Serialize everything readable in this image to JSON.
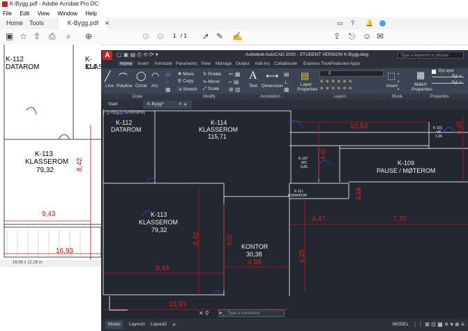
{
  "acrobat": {
    "window_title": "K-Bygg.pdf - Adobe Acrobat Pro DC",
    "menu": [
      "File",
      "Edit",
      "View",
      "Window",
      "Help"
    ],
    "tabs": {
      "home": "Home",
      "tools": "Tools",
      "doc": "K-Bygg.pdf"
    },
    "page_current": "1",
    "page_total": "/ 1",
    "status_size": "16,56 x 12,26 in",
    "rooms": [
      {
        "code": "K-112",
        "name": "DATAROM"
      },
      {
        "code": "K-113",
        "name": "KLASSEROM",
        "area": "79,32"
      },
      {
        "code": "K-114",
        "name": "KLASSE"
      }
    ],
    "dims": [
      "8,42",
      "9,43",
      "16,93"
    ]
  },
  "autocad": {
    "title": "Autodesk AutoCAD 2020 - STUDENT VERSION    K-Bygg.dwg",
    "search_placeholder": "Type a keyword or phrase",
    "ribbon_tabs": [
      "Home",
      "Insert",
      "Annotate",
      "Parametric",
      "View",
      "Manage",
      "Output",
      "Add-ins",
      "Collaborate",
      "Express Tools",
      "Featured Apps"
    ],
    "draw_tools": [
      "Line",
      "Polyline",
      "Circle",
      "Arc"
    ],
    "modify_tools": [
      "Move",
      "Rotate",
      "Copy",
      "Mirror",
      "Stretch",
      "Scale"
    ],
    "annotation_tools": [
      "Text",
      "Dimension"
    ],
    "layer_tools": [
      "Layer Properties"
    ],
    "layer_value": "0",
    "block_tools": [
      "Insert"
    ],
    "properties_tools": [
      "Match Properties"
    ],
    "bylayer": [
      "ByLayer",
      "ByLa",
      "ByLa"
    ],
    "panels": [
      "Draw",
      "Modify",
      "Annotation",
      "Layers",
      "Block",
      "Properties"
    ],
    "file_tabs": {
      "start": "Start",
      "doc": "K-Bygg*"
    },
    "viewport_label": "[−][Top][2D Wireframe]",
    "rooms": [
      {
        "code": "K-112",
        "name": "DATAROM"
      },
      {
        "code": "K-114",
        "name": "KLASSEROM",
        "area": "115,71"
      },
      {
        "code": "K-101",
        "name": "VF",
        "area": "1,96"
      },
      {
        "code": "K-107",
        "name": "WC",
        "area": "6,85"
      },
      {
        "code": "K-109",
        "name": "PAUSE / MØTEROM"
      },
      {
        "code": "K-111",
        "name": "KORRIDOR"
      },
      {
        "code": "K-113",
        "name": "KLASSEROM",
        "area": "79,32"
      },
      {
        "code": "",
        "name": "KONTOR",
        "area": "30,38"
      }
    ],
    "dims": [
      "10,53",
      "8,45",
      "4,45",
      "2,19",
      "4,47",
      "7,70",
      "8,42",
      "8,02",
      "6,25",
      "9,43",
      "4,58",
      "16,93"
    ],
    "command_placeholder": "Type a command",
    "layout_tabs": [
      "Model",
      "Layout1",
      "Layout2"
    ],
    "status_model": "MODEL"
  }
}
